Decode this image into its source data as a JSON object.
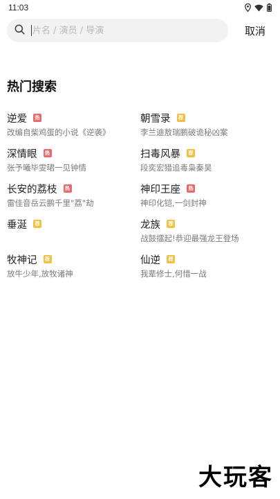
{
  "status_bar": {
    "time": "11:03",
    "icons": [
      "location-icon",
      "wifi-icon",
      "battery-icon"
    ]
  },
  "search": {
    "value": "",
    "placeholder": "片名 / 演员 / 导演",
    "cancel_label": "取消"
  },
  "hot_search": {
    "title": "热门搜索",
    "colors": {
      "hot": "#e86a6a",
      "recommend": "#f2c046"
    },
    "items": [
      {
        "title": "逆爱",
        "badge": "热",
        "badge_type": "hot",
        "desc": "改编自柴鸡蛋的小说《逆袭》"
      },
      {
        "title": "朝雪录",
        "badge": "荐",
        "badge_type": "recommend",
        "desc": "李兰迪敖瑞鹏破诡秘凶案"
      },
      {
        "title": "深情眼",
        "badge": "热",
        "badge_type": "hot",
        "desc": "张予曦毕雯珺一见钟情"
      },
      {
        "title": "扫毒风暴",
        "badge": "荐",
        "badge_type": "recommend",
        "desc": "段奕宏猎追毒枭秦昊"
      },
      {
        "title": "长安的荔枝",
        "badge": "热",
        "badge_type": "hot",
        "desc": "雷佳音岳云鹏千里\"荔\"劫"
      },
      {
        "title": "神印王座",
        "badge": "热",
        "badge_type": "hot",
        "desc": "神印化铠,一剑封神"
      },
      {
        "title": "垂涎",
        "badge": "荐",
        "badge_type": "recommend",
        "desc": ""
      },
      {
        "title": "龙族",
        "badge": "荐",
        "badge_type": "recommend",
        "desc": "战鼓擂起!恭迎最强龙王登场"
      },
      {
        "title": "牧神记",
        "badge": "荐",
        "badge_type": "recommend",
        "desc": "放牛少年,放牧诸神"
      },
      {
        "title": "仙逆",
        "badge": "荐",
        "badge_type": "recommend",
        "desc": "我辈修士,何惜一战"
      }
    ]
  },
  "watermark": "大玩客"
}
